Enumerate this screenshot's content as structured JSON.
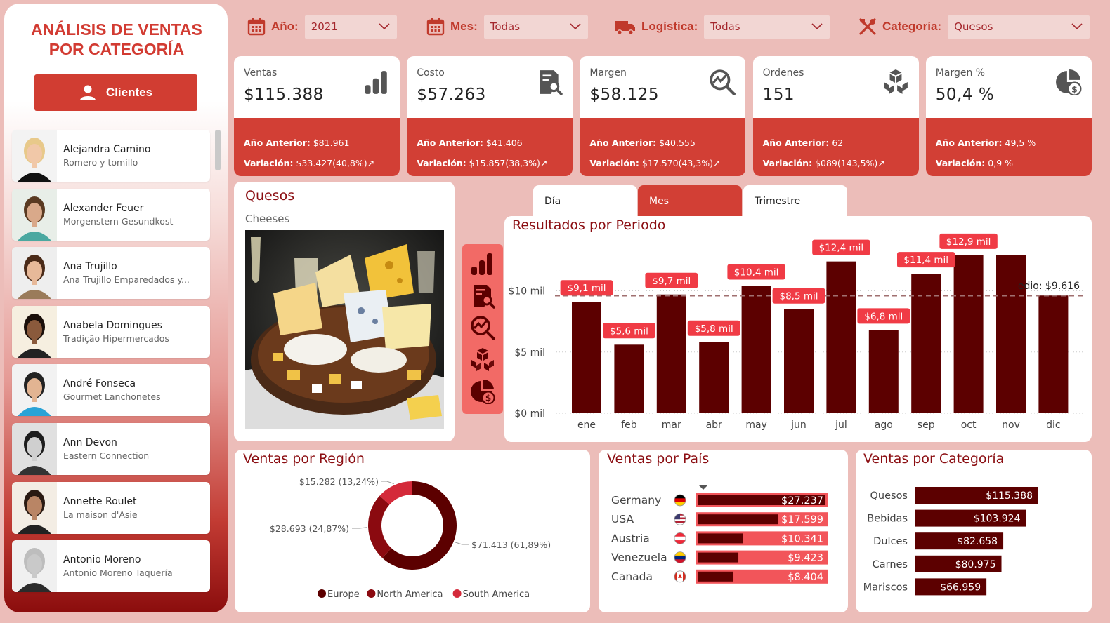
{
  "sidebar": {
    "title_line1": "ANÁLISIS DE VENTAS",
    "title_line2": "POR CATEGORÍA",
    "clients_button": "Clientes",
    "clients": [
      {
        "name": "Alejandra Camino",
        "company": "Romero y tomillo"
      },
      {
        "name": "Alexander Feuer",
        "company": "Morgenstern Gesundkost"
      },
      {
        "name": "Ana Trujillo",
        "company": "Ana Trujillo Emparedados y..."
      },
      {
        "name": "Anabela Domingues",
        "company": "Tradição Hipermercados"
      },
      {
        "name": "André Fonseca",
        "company": "Gourmet Lanchonetes"
      },
      {
        "name": "Ann Devon",
        "company": "Eastern Connection"
      },
      {
        "name": "Annette Roulet",
        "company": "La maison d'Asie"
      },
      {
        "name": "Antonio Moreno",
        "company": "Antonio Moreno Taquería"
      }
    ]
  },
  "filters": {
    "year": {
      "label": "Año:",
      "value": "2021"
    },
    "month": {
      "label": "Mes:",
      "value": "Todas"
    },
    "logistics": {
      "label": "Logística:",
      "value": "Todas"
    },
    "category": {
      "label": "Categoría:",
      "value": "Quesos"
    }
  },
  "kpis": [
    {
      "label": "Ventas",
      "value": "$115.388",
      "prev_label": "Año Anterior:",
      "prev": "$81.961",
      "var_label": "Variación:",
      "var": "$33.427(40,8%)↗",
      "icon": "bar-chart-icon"
    },
    {
      "label": "Costo",
      "value": "$57.263",
      "prev_label": "Año Anterior:",
      "prev": "$41.406",
      "var_label": "Variación:",
      "var": "$15.857(38,3%)↗",
      "icon": "document-search-icon"
    },
    {
      "label": "Margen",
      "value": "$58.125",
      "prev_label": "Año Anterior:",
      "prev": "$40.555",
      "var_label": "Variación:",
      "var": "$17.570(43,3%)↗",
      "icon": "trend-search-icon"
    },
    {
      "label": "Ordenes",
      "value": "151",
      "prev_label": "Año Anterior:",
      "prev": "62",
      "var_label": "Variación:",
      "var": "$089(143,5%)↗",
      "icon": "boxes-icon"
    },
    {
      "label": "Margen %",
      "value": "50,4 %",
      "prev_label": "Año Anterior:",
      "prev": "49,5 %",
      "var_label": "Variación:",
      "var": "0,9 %",
      "icon": "pie-dollar-icon"
    }
  ],
  "category_card": {
    "title": "Quesos",
    "subtitle": "Cheeses"
  },
  "tabs": [
    "Día",
    "Mes",
    "Trimestre"
  ],
  "active_tab": "Mes",
  "colors": {
    "accent": "#d23f35",
    "dark": "#5c0000",
    "light_red": "#f2555a",
    "bg": "#ecbdb9"
  },
  "chart_data": [
    {
      "type": "bar",
      "title": "Resultados por Periodo",
      "categories": [
        "ene",
        "feb",
        "mar",
        "abr",
        "may",
        "jun",
        "jul",
        "ago",
        "sep",
        "oct",
        "nov",
        "dic"
      ],
      "values": [
        9100,
        5600,
        9700,
        5800,
        10400,
        8500,
        12400,
        6800,
        11400,
        12900,
        12900,
        9616
      ],
      "data_labels": [
        "$9,1 mil",
        "$5,6 mil",
        "$9,7 mil",
        "$5,8 mil",
        "$10,4 mil",
        "$8,5 mil",
        "$12,4 mil",
        "$6,8 mil",
        "$11,4 mil",
        "$12,9 mil",
        "",
        ""
      ],
      "y_ticks": [
        0,
        5000,
        10000
      ],
      "y_tick_labels": [
        "$0 mil",
        "$5 mil",
        "$10 mil"
      ],
      "ylim": [
        0,
        14500
      ],
      "average": 9616,
      "average_label": "edio: $9.616"
    },
    {
      "type": "pie",
      "title": "Ventas por Región",
      "categories": [
        "Europe",
        "North America",
        "South America"
      ],
      "values": [
        71413,
        28693,
        15282
      ],
      "slice_labels": [
        "$71.413 (61,89%)",
        "$28.693 (24,87%)",
        "$15.282 (13,24%)"
      ],
      "colors": [
        "#5c0000",
        "#8b0a10",
        "#d42a3a"
      ],
      "legend": "bottom"
    },
    {
      "type": "bar",
      "title": "Ventas por País",
      "categories": [
        "Germany",
        "USA",
        "Austria",
        "Venezuela",
        "Canada"
      ],
      "values": [
        27237,
        17599,
        10341,
        9423,
        8404
      ],
      "data_labels": [
        "$27.237",
        "$17.599",
        "$10.341",
        "$9.423",
        "$8.404"
      ],
      "target": 27237
    },
    {
      "type": "bar",
      "title": "Ventas por Categoría",
      "categories": [
        "Quesos",
        "Bebidas",
        "Dulces",
        "Carnes",
        "Mariscos"
      ],
      "values": [
        115388,
        103924,
        82658,
        80975,
        66959
      ],
      "data_labels": [
        "$115.388",
        "$103.924",
        "$82.658",
        "$80.975",
        "$66.959"
      ]
    }
  ]
}
